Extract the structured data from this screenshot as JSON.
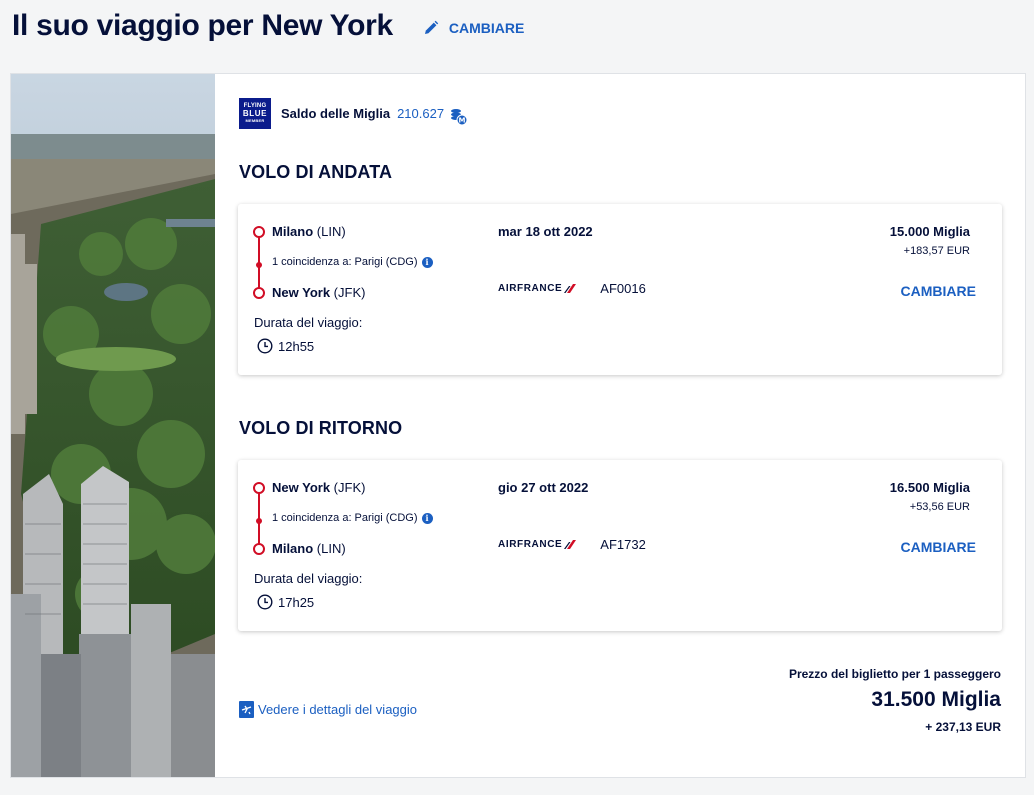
{
  "header": {
    "title": "Il suo viaggio per New York",
    "change_label": "CAMBIARE"
  },
  "hero": {
    "icon": "central-park-aerial-photo"
  },
  "miles": {
    "logo_line1": "FLYING",
    "logo_line2": "BLUE",
    "logo_line3": "MEMBER",
    "label": "Saldo delle Miglia",
    "value": "210.627"
  },
  "outbound": {
    "section_title": "VOLO DI ANDATA",
    "origin_city": "Milano",
    "origin_code": "(LIN)",
    "connection": "1 coincidenza a: Parigi (CDG)",
    "destination_city": "New York",
    "destination_code": "(JFK)",
    "duration_label": "Durata del viaggio:",
    "duration": "12h55",
    "date": "mar 18 ott 2022",
    "airline": "AIRFRANCE",
    "flight_number": "AF0016",
    "miles": "15.000  Miglia",
    "eur": "+183,57 EUR",
    "change_label": "CAMBIARE"
  },
  "return": {
    "section_title": "VOLO DI RITORNO",
    "origin_city": "New York",
    "origin_code": "(JFK)",
    "connection": "1 coincidenza a: Parigi (CDG)",
    "destination_city": "Milano",
    "destination_code": "(LIN)",
    "duration_label": "Durata del viaggio:",
    "duration": "17h25",
    "date": "gio 27 ott 2022",
    "airline": "AIRFRANCE",
    "flight_number": "AF1732",
    "miles": "16.500  Miglia",
    "eur": "+53,56 EUR",
    "change_label": "CAMBIARE"
  },
  "details_link": "Vedere i dettagli del viaggio",
  "total": {
    "label": "Prezzo del biglietto per 1 passeggero",
    "miles": "31.500  Miglia",
    "eur": "+ 237,13 EUR"
  },
  "colors": {
    "primary_text": "#051039",
    "link": "#1b5fc1",
    "route": "#d10d25",
    "flying_blue": "#0b1c8c"
  }
}
